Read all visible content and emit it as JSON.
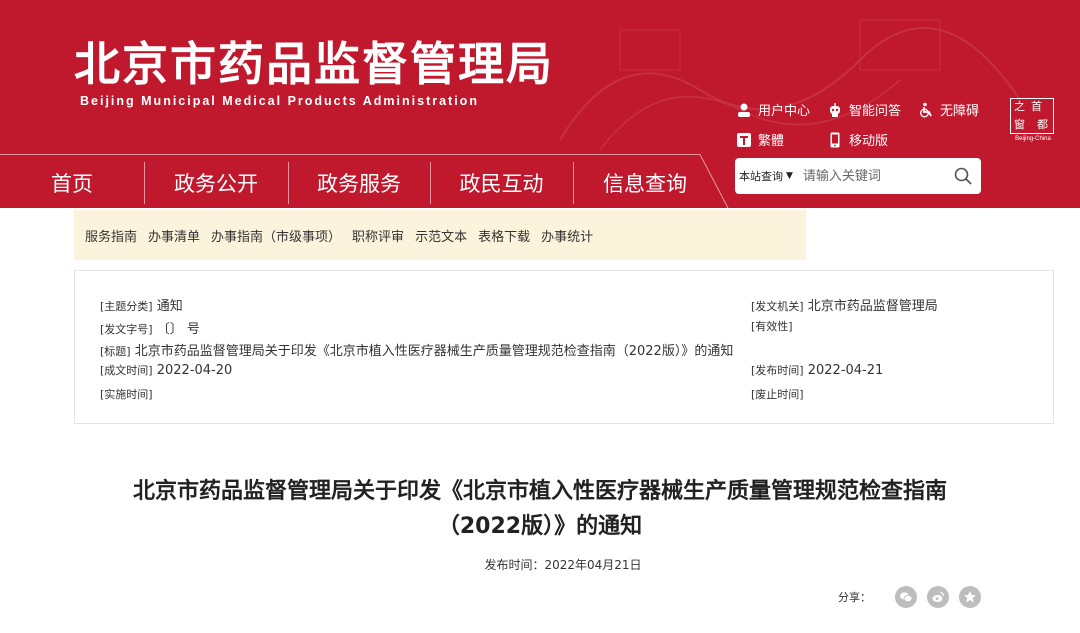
{
  "header": {
    "title": "北京市药品监督管理局",
    "subtitle": "Beijing Municipal Medical Products Administration",
    "utils": [
      {
        "label": "用户中心",
        "icon": "user-icon"
      },
      {
        "label": "智能问答",
        "icon": "robot-icon"
      },
      {
        "label": "无障碍",
        "icon": "accessibility-icon"
      },
      {
        "label": "繁體",
        "icon": "traditional-chinese-icon"
      },
      {
        "label": "移动版",
        "icon": "mobile-icon"
      }
    ],
    "seal": {
      "chars": [
        "首",
        "都",
        "之",
        "窗"
      ],
      "sub": "Beijing-China"
    }
  },
  "nav": {
    "items": [
      "首页",
      "政务公开",
      "政务服务",
      "政民互动",
      "信息查询"
    ]
  },
  "search": {
    "scope": "本站查询",
    "placeholder": "请输入关键词"
  },
  "subnav": {
    "items": [
      "服务指南",
      "办事清单",
      "办事指南（市级事项）",
      "职称评审",
      "示范文本",
      "表格下载",
      "办事统计"
    ]
  },
  "info": {
    "topic_label": "[主题分类]",
    "topic_value": "通知",
    "issuer_label": "[发文机关]",
    "issuer_value": "北京市药品监督管理局",
    "docno_label": "[发文字号]",
    "docno_value": "〔〕 号",
    "validity_label": "[有效性]",
    "validity_value": "",
    "title_label": "[标题]",
    "title_value": "北京市药品监督管理局关于印发《北京市植入性医疗器械生产质量管理规范检查指南（2022版）》的通知",
    "created_label": "[成文时间]",
    "created_value": "2022-04-20",
    "published_label": "[发布时间]",
    "published_value": "2022-04-21",
    "effective_label": "[实施时间]",
    "effective_value": "",
    "expired_label": "[废止时间]",
    "expired_value": ""
  },
  "article": {
    "title_line1": "北京市药品监督管理局关于印发《北京市植入性医疗器械生产质量管理规范检查指南",
    "title_line2": "（2022版）》的通知",
    "pubdate": "发布时间：2022年04月21日"
  },
  "share": {
    "label": "分享：",
    "icons": [
      "wechat-icon",
      "weibo-icon",
      "qzone-icon"
    ]
  },
  "colors": {
    "brand_red": "#c0182d",
    "subnav_bg": "#fcf3dc",
    "share_gray": "#bdbdbd"
  }
}
